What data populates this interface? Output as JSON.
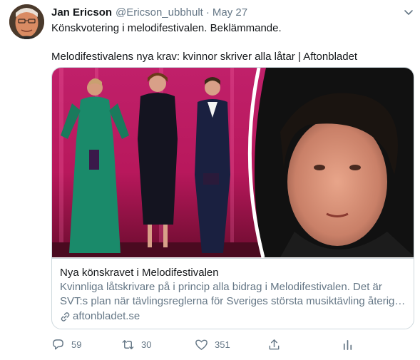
{
  "tweet": {
    "author_name": "Jan Ericson",
    "handle": "@Ericson_ubbhult",
    "separator": "·",
    "date": "May 27",
    "text_line1": "Könskvotering i melodifestivalen. Beklämmande.",
    "text_line2": "Melodifestivalens nya krav: kvinnor skriver alla låtar | Aftonbladet"
  },
  "card": {
    "title": "Nya könskravet i Melodifestivalen",
    "description_line1": "Kvinnliga låtskrivare på i princip alla bidrag i Melodifestivalen. Det är",
    "description_line2": "SVT:s plan när tävlingsreglerna för Sveriges största musiktävling återige...",
    "domain": "aftonbladet.se"
  },
  "actions": {
    "reply_count": "59",
    "retweet_count": "30",
    "like_count": "351"
  },
  "icons": {
    "menu": "chevron-down-icon",
    "link": "link-icon",
    "reply": "reply-icon",
    "retweet": "retweet-icon",
    "like": "heart-icon",
    "share": "share-icon",
    "analytics": "analytics-icon"
  },
  "colors": {
    "text_primary": "#14171a",
    "text_secondary": "#657786",
    "border": "#cfd9de"
  }
}
